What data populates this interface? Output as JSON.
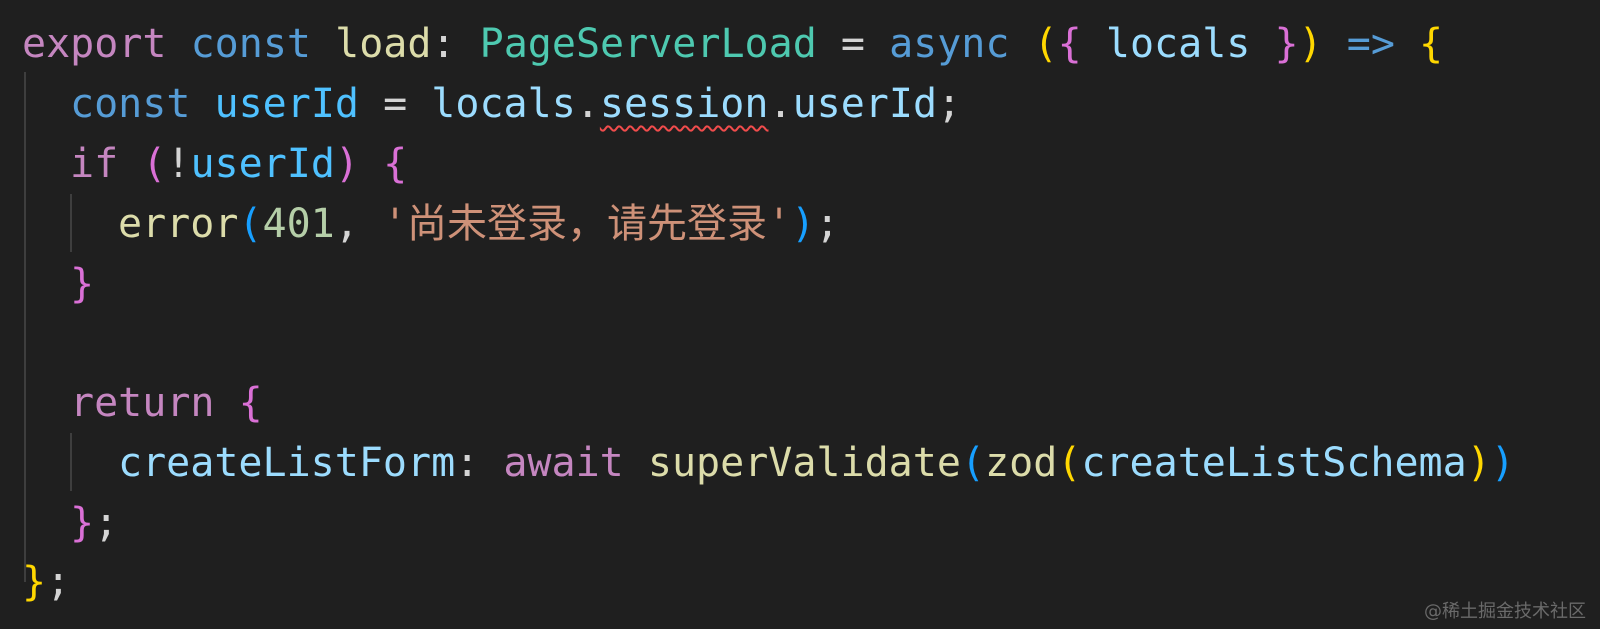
{
  "colors": {
    "background": "#1f1f1f",
    "indent_guide": "#3e3e3e",
    "keyword_blue": "#569cd6",
    "keyword_purple": "#c586c0",
    "type_green": "#4ec9b0",
    "function_yellow": "#dcdcaa",
    "variable_lightblue": "#9cdcfe",
    "constant_blue": "#4fc1ff",
    "string_orange": "#ce9178",
    "number_green": "#b5cea8",
    "bracket_gold": "#ffd700",
    "bracket_pink": "#da70d6",
    "bracket_blue": "#179fff",
    "default_text": "#d4d4d4",
    "error_squiggle": "#f14c4c"
  },
  "code": {
    "line1": {
      "export": "export",
      "const": "const",
      "load": "load",
      "colon": ":",
      "type": "PageServerLoad",
      "eq": "=",
      "async": "async",
      "paren_open": "(",
      "brace_open": "{",
      "locals": "locals",
      "brace_close": "}",
      "paren_close": ")",
      "arrow": "=>",
      "body_open": "{"
    },
    "line2": {
      "const": "const",
      "userId": "userId",
      "eq": "=",
      "locals": "locals",
      "dot1": ".",
      "session": "session",
      "dot2": ".",
      "userId_prop": "userId",
      "semi": ";"
    },
    "line3": {
      "if": "if",
      "paren_open": "(",
      "not": "!",
      "userId": "userId",
      "paren_close": ")",
      "brace_open": "{"
    },
    "line4": {
      "error": "error",
      "paren_open": "(",
      "code": "401",
      "comma": ",",
      "message": "'尚未登录，请先登录'",
      "paren_close": ")",
      "semi": ";"
    },
    "line5": {
      "brace_close": "}"
    },
    "line7": {
      "return": "return",
      "brace_open": "{"
    },
    "line8": {
      "prop": "createListForm",
      "colon": ":",
      "await": "await",
      "fn": "superValidate",
      "paren1": "(",
      "zod": "zod",
      "paren2": "(",
      "schema": "createListSchema",
      "paren2_close": ")",
      "paren1_close": ")"
    },
    "line9": {
      "brace_close": "}",
      "semi": ";"
    },
    "line10": {
      "brace_close": "}",
      "semi": ";"
    }
  },
  "watermark": "@稀土掘金技术社区"
}
